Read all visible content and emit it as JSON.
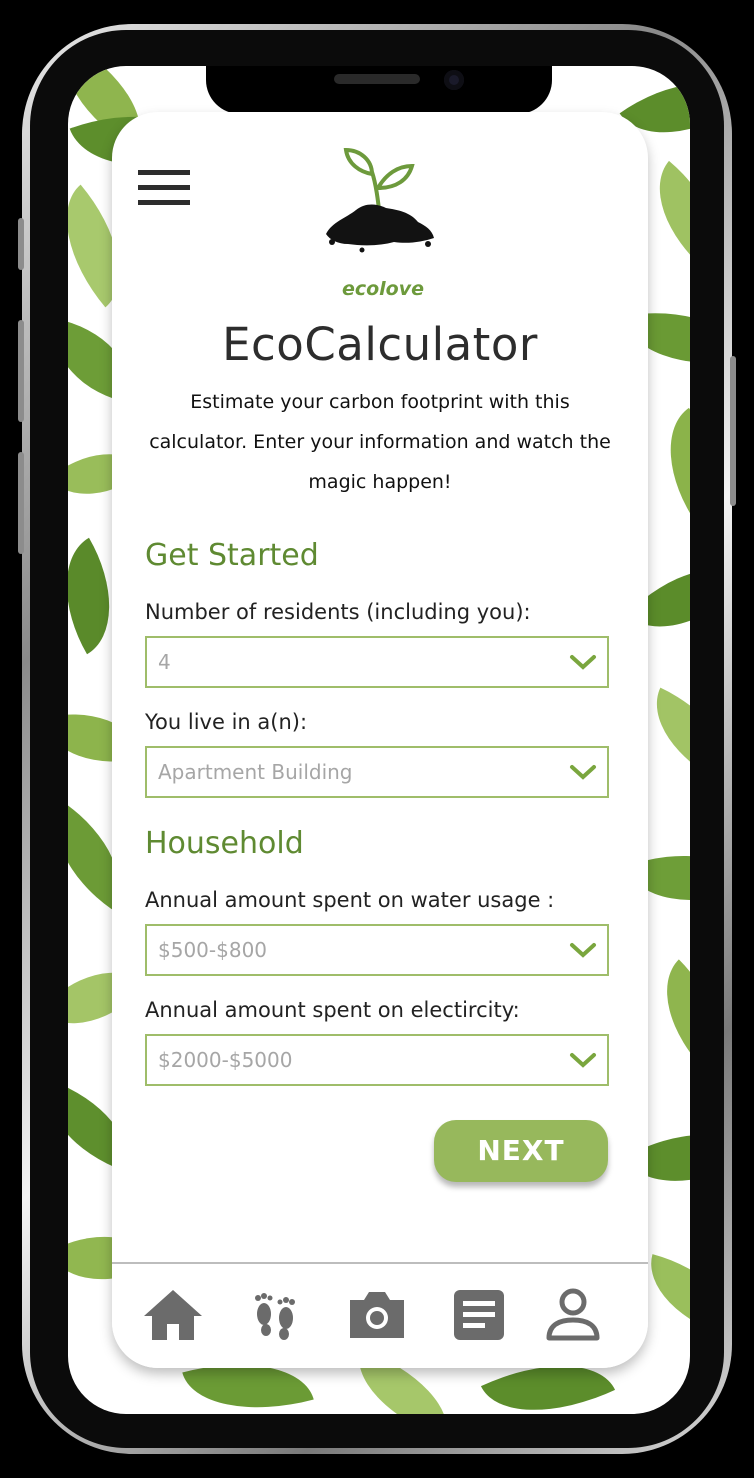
{
  "app": {
    "logo_text": "ecolove",
    "title": "EcoCalculator",
    "subtitle": "Estimate your carbon footprint with this calculator. Enter your information and watch the magic happen!"
  },
  "sections": {
    "get_started": "Get Started",
    "household": "Household"
  },
  "fields": {
    "residents": {
      "label": "Number of residents (including you):",
      "value": "4"
    },
    "dwelling": {
      "label": "You live in a(n):",
      "value": "Apartment Building"
    },
    "water": {
      "label": "Annual amount spent on water usage :",
      "value": "$500-$800"
    },
    "electricity": {
      "label": "Annual amount spent on electircity:",
      "value": "$2000-$5000"
    }
  },
  "actions": {
    "next_label": "NEXT"
  },
  "tabbar": [
    "home-icon",
    "footprint-icon",
    "camera-icon",
    "notes-icon",
    "profile-icon"
  ],
  "colors": {
    "accent": "#97b85c",
    "section_green": "#5f8a32",
    "field_border": "#9fbd6a",
    "chevron": "#7aa63e",
    "tab_icon": "#6b6b6b"
  }
}
